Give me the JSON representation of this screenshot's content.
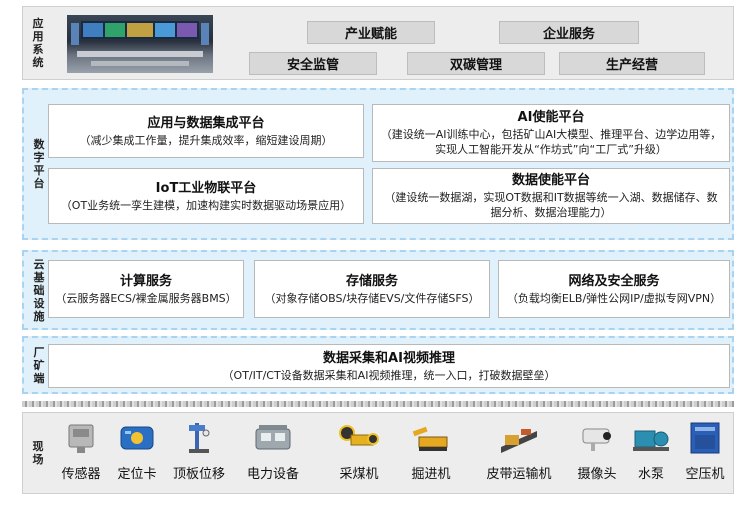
{
  "layers": {
    "application": {
      "label": [
        "应",
        "用",
        "系",
        "统"
      ],
      "buttons": [
        "产业赋能",
        "企业服务",
        "安全监管",
        "双碳管理",
        "生产经营"
      ]
    },
    "digital_platform": {
      "label": [
        "数",
        "字",
        "平",
        "台"
      ],
      "cards": [
        {
          "title": "应用与数据集成平台",
          "desc": "（减少集成工作量，提升集成效率，缩短建设周期）"
        },
        {
          "title": "AI使能平台",
          "desc": "（建设统一AI训练中心，包括矿山AI大模型、推理平台、边学边用等，实现人工智能开发从“作坊式”向“工厂式”升级）"
        },
        {
          "title": "IoT工业物联平台",
          "desc": "（OT业务统一孪生建模，加速构建实时数据驱动场景应用）"
        },
        {
          "title": "数据使能平台",
          "desc": "（建设统一数据湖，实现OT数据和IT数据等统一入湖、数据储存、数据分析、数据治理能力）"
        }
      ]
    },
    "cloud_infra": {
      "label": [
        "云",
        "基",
        "础",
        "设",
        "施"
      ],
      "cards": [
        {
          "title": "计算服务",
          "desc": "（云服务器ECS/裸金属服务器BMS）"
        },
        {
          "title": "存储服务",
          "desc": "（对象存储OBS/块存储EVS/文件存储SFS）"
        },
        {
          "title": "网络及安全服务",
          "desc": "（负载均衡ELB/弹性公网IP/虚拟专网VPN）"
        }
      ]
    },
    "plant_edge": {
      "label": [
        "厂",
        "矿",
        "端"
      ],
      "card": {
        "title": "数据采集和AI视频推理",
        "desc": "（OT/IT/CT设备数据采集和AI视频推理，统一入口，打破数据壁垒）"
      }
    },
    "field": {
      "label": [
        "现",
        "场"
      ],
      "devices": [
        {
          "name": "传感器",
          "icon": "sensor-icon"
        },
        {
          "name": "定位卡",
          "icon": "locator-card-icon"
        },
        {
          "name": "顶板位移",
          "icon": "roof-displacement-icon"
        },
        {
          "name": "电力设备",
          "icon": "power-equipment-icon"
        },
        {
          "name": "采煤机",
          "icon": "shearer-icon"
        },
        {
          "name": "掘进机",
          "icon": "roadheader-icon"
        },
        {
          "name": "皮带运输机",
          "icon": "belt-conveyor-icon"
        },
        {
          "name": "摄像头",
          "icon": "camera-icon"
        },
        {
          "name": "水泵",
          "icon": "water-pump-icon"
        },
        {
          "name": "空压机",
          "icon": "air-compressor-icon"
        }
      ]
    }
  },
  "colors": {
    "panel_blue": "#e0f1fb",
    "panel_border": "#a9d3ee",
    "grey_panel": "#ededed"
  }
}
